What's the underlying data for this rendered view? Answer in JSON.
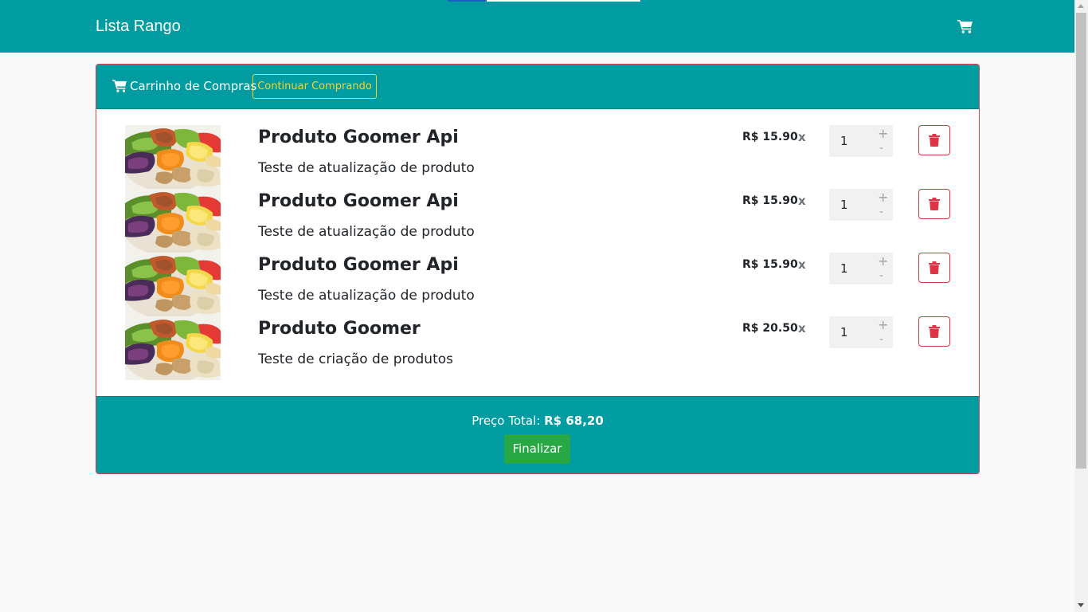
{
  "navbar": {
    "brand": "Lista Rango",
    "cart_icon": "shopping-cart-icon"
  },
  "cart": {
    "header_icon": "shopping-cart-icon",
    "title": "Carrinho de Compras",
    "continue_label": "Continuar Comprando",
    "items": [
      {
        "name": "Produto Goomer Api",
        "description": "Teste de atualização de produto",
        "price": "R$ 15.90",
        "times": "x",
        "quantity": "1",
        "plus": "+",
        "minus": "-"
      },
      {
        "name": "Produto Goomer Api",
        "description": "Teste de atualização de produto",
        "price": "R$ 15.90",
        "times": "x",
        "quantity": "1",
        "plus": "+",
        "minus": "-"
      },
      {
        "name": "Produto Goomer Api",
        "description": "Teste de atualização de produto",
        "price": "R$ 15.90",
        "times": "x",
        "quantity": "1",
        "plus": "+",
        "minus": "-"
      },
      {
        "name": "Produto Goomer",
        "description": "Teste de criação de produtos",
        "price": "R$ 20.50",
        "times": "x",
        "quantity": "1",
        "plus": "+",
        "minus": "-"
      }
    ],
    "delete_icon": "trash-icon",
    "total_label": "Preço Total:",
    "total_value": "R$ 68,20",
    "finish_label": "Finalizar"
  },
  "colors": {
    "primary": "#009ca1",
    "warning": "#ffd21f",
    "danger": "#dc3545",
    "success": "#28a745"
  }
}
